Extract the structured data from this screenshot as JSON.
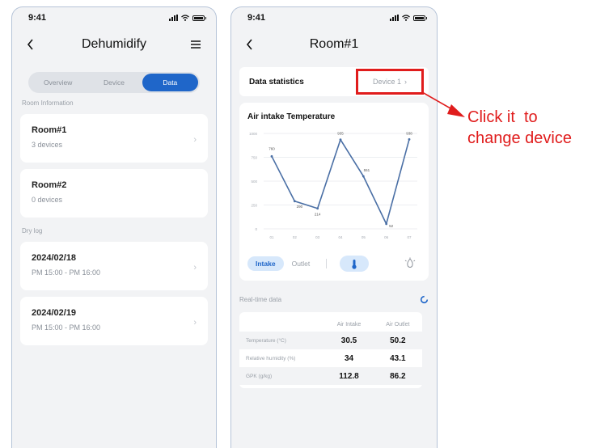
{
  "left": {
    "status_time": "9:41",
    "title": "Dehumidify",
    "tabs": [
      {
        "label": "Overview",
        "active": false
      },
      {
        "label": "Device",
        "active": false
      },
      {
        "label": "Data",
        "active": true
      }
    ],
    "room_section_label": "Room Information",
    "rooms": [
      {
        "name": "Room#1",
        "detail": "3 devices"
      },
      {
        "name": "Room#2",
        "detail": "0 devices"
      }
    ],
    "log_section_label": "Dry log",
    "logs": [
      {
        "date": "2024/02/18",
        "time": "PM 15:00 - PM 16:00"
      },
      {
        "date": "2024/02/19",
        "time": "PM 15:00 - PM 16:00"
      }
    ]
  },
  "right": {
    "status_time": "9:41",
    "title": "Room#1",
    "data_stats_label": "Data statistics",
    "device_selector": "Device 1",
    "chart_title": "Air intake Temperature",
    "toggle_intake": "Intake",
    "toggle_outlet": "Outlet",
    "realtime_label": "Real-time data",
    "table": {
      "columns": [
        "",
        "Air Intake",
        "Air Outlet"
      ],
      "rows": [
        {
          "label": "Temperature (°C)",
          "intake": "30.5",
          "outlet": "50.2"
        },
        {
          "label": "Relative humidity (%)",
          "intake": "34",
          "outlet": "43.1"
        },
        {
          "label": "GPK (g/kg)",
          "intake": "112.8",
          "outlet": "86.2"
        }
      ]
    }
  },
  "chart_data": {
    "type": "line",
    "x": [
      "01",
      "02",
      "03",
      "04",
      "05",
      "06",
      "07"
    ],
    "values": [
      760,
      290,
      214,
      935,
      551,
      52,
      938
    ],
    "y_ticks": [
      0,
      250,
      500,
      750,
      1000
    ],
    "ylim": [
      0,
      1000
    ],
    "title": "Air intake Temperature",
    "color": "#4a6fa5"
  },
  "annotation": {
    "line1": "Click it  to",
    "line2": "change device",
    "color": "#e01c1c"
  },
  "colors": {
    "accent": "#1f66c9",
    "highlight_border": "#e01c1c",
    "background": "#f2f3f5"
  }
}
